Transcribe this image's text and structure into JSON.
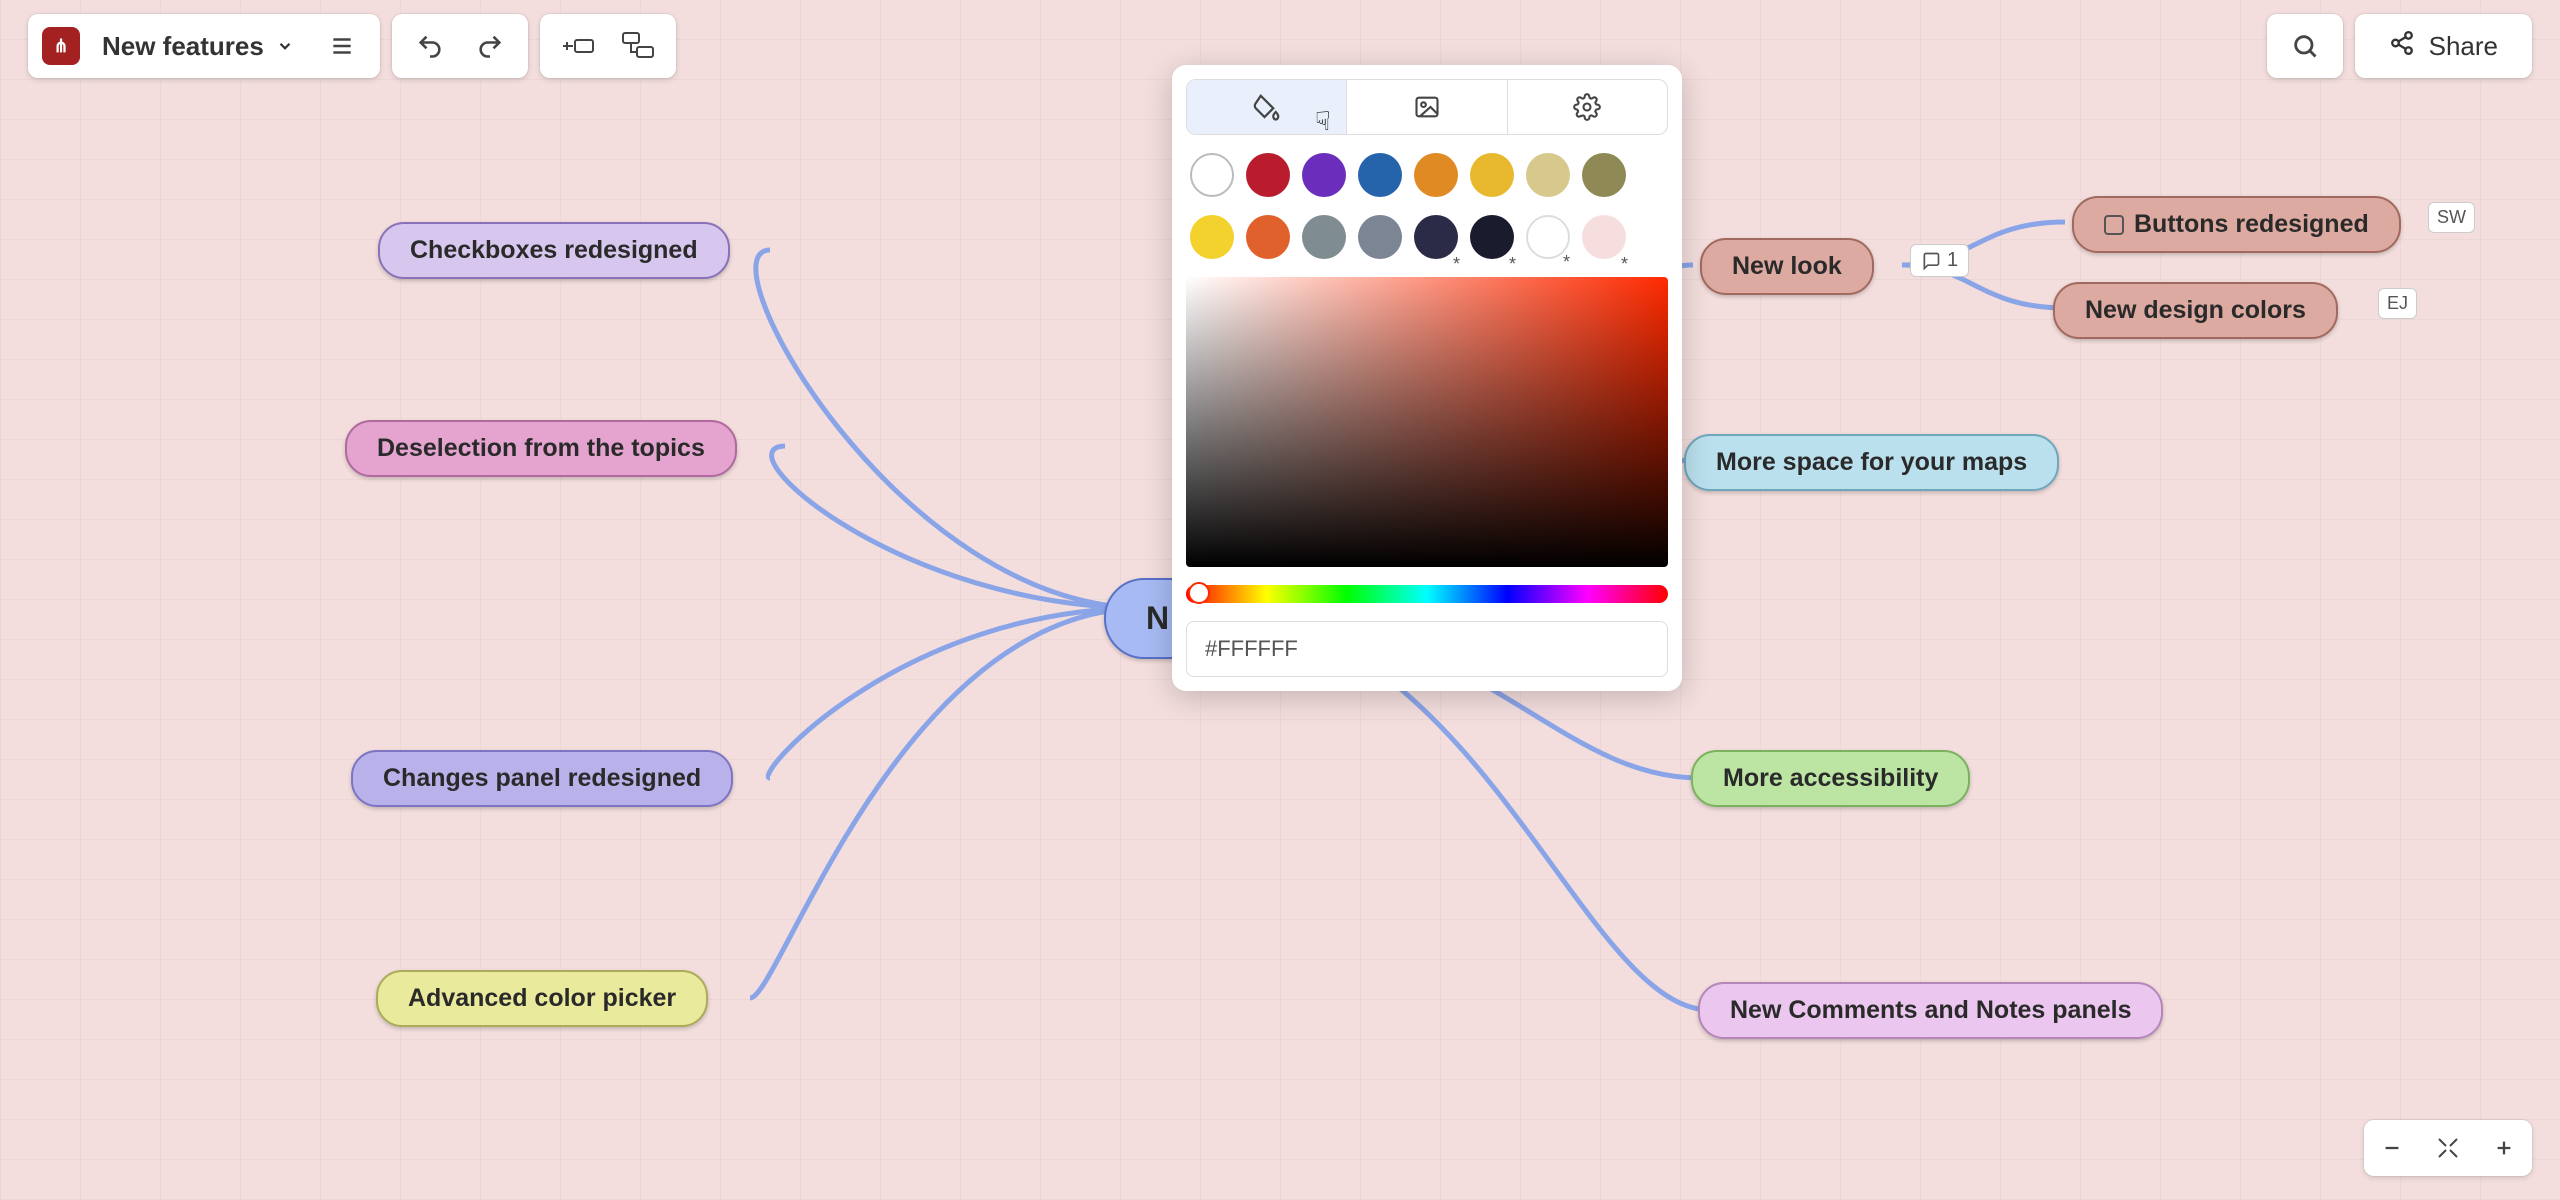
{
  "header": {
    "title": "New features",
    "share_label": "Share"
  },
  "nodes": {
    "center": "N",
    "checkboxes": "Checkboxes redesigned",
    "deselection": "Deselection from the topics",
    "changes_panel": "Changes panel redesigned",
    "color_picker": "Advanced color picker",
    "new_look": "New look",
    "more_space": "More space for your maps",
    "accessibility": "More accessibility",
    "comments_notes": "New Comments and Notes panels",
    "buttons_redesigned": "Buttons redesigned",
    "design_colors": "New design colors"
  },
  "badges": {
    "comment_count": "1",
    "sw": "SW",
    "ej": "EJ"
  },
  "picker": {
    "hex": "#FFFFFF",
    "swatches": [
      {
        "color": "#ffffff",
        "none": true
      },
      {
        "color": "#b91d2d"
      },
      {
        "color": "#6b2dbb"
      },
      {
        "color": "#2563ab"
      },
      {
        "color": "#e08a24"
      },
      {
        "color": "#e8b92e"
      },
      {
        "color": "#d6c98b"
      },
      {
        "color": "#8f8956"
      }
    ],
    "swatches2": [
      {
        "color": "#f3d22e"
      },
      {
        "color": "#e0612c"
      },
      {
        "color": "#7f8d93"
      },
      {
        "color": "#7b8594"
      },
      {
        "color": "#2b2b47",
        "ast": true
      },
      {
        "color": "#1b1b2e",
        "ast": true
      },
      {
        "color": "#ffffff",
        "ast": true,
        "none": false,
        "bordered": true
      },
      {
        "color": "#f7dede",
        "ast": true
      }
    ]
  }
}
